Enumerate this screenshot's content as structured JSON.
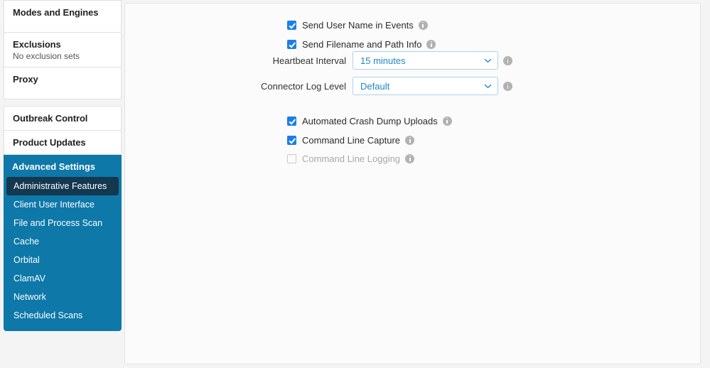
{
  "sidebar": {
    "cards": [
      {
        "title": "Modes and Engines",
        "subtitle": ""
      },
      {
        "title": "Exclusions",
        "subtitle": "No exclusion sets"
      },
      {
        "title": "Proxy",
        "subtitle": ""
      }
    ],
    "cards2": [
      {
        "title": "Outbreak Control",
        "subtitle": ""
      },
      {
        "title": "Product Updates",
        "subtitle": ""
      }
    ],
    "advanced": {
      "header": "Advanced Settings",
      "items": [
        {
          "label": "Administrative Features",
          "selected": true
        },
        {
          "label": "Client User Interface",
          "selected": false
        },
        {
          "label": "File and Process Scan",
          "selected": false
        },
        {
          "label": "Cache",
          "selected": false
        },
        {
          "label": "Orbital",
          "selected": false
        },
        {
          "label": "ClamAV",
          "selected": false
        },
        {
          "label": "Network",
          "selected": false
        },
        {
          "label": "Scheduled Scans",
          "selected": false
        }
      ]
    }
  },
  "main": {
    "checkbox_group_top": [
      {
        "label": "Send User Name in Events",
        "checked": true,
        "disabled": false
      },
      {
        "label": "Send Filename and Path Info",
        "checked": true,
        "disabled": false
      }
    ],
    "selects": [
      {
        "label": "Heartbeat Interval",
        "value": "15 minutes"
      },
      {
        "label": "Connector Log Level",
        "value": "Default"
      }
    ],
    "checkbox_group_bottom": [
      {
        "label": "Automated Crash Dump Uploads",
        "checked": true,
        "disabled": false
      },
      {
        "label": "Command Line Capture",
        "checked": true,
        "disabled": false
      },
      {
        "label": "Command Line Logging",
        "checked": false,
        "disabled": true
      }
    ]
  },
  "colors": {
    "accent_blue": "#0e78a8",
    "selected_item": "#13384f",
    "checkbox_blue": "#1a7fe8",
    "select_text": "#1f87c7",
    "select_border": "#a9d4e8",
    "info_icon_gray": "#b2b2b2",
    "panel_bg": "#fbfbfb",
    "page_bg": "#f4f4f4"
  },
  "icons": {
    "info": "info-icon",
    "chevron": "chevron-down-icon",
    "check": "checkmark-icon"
  }
}
